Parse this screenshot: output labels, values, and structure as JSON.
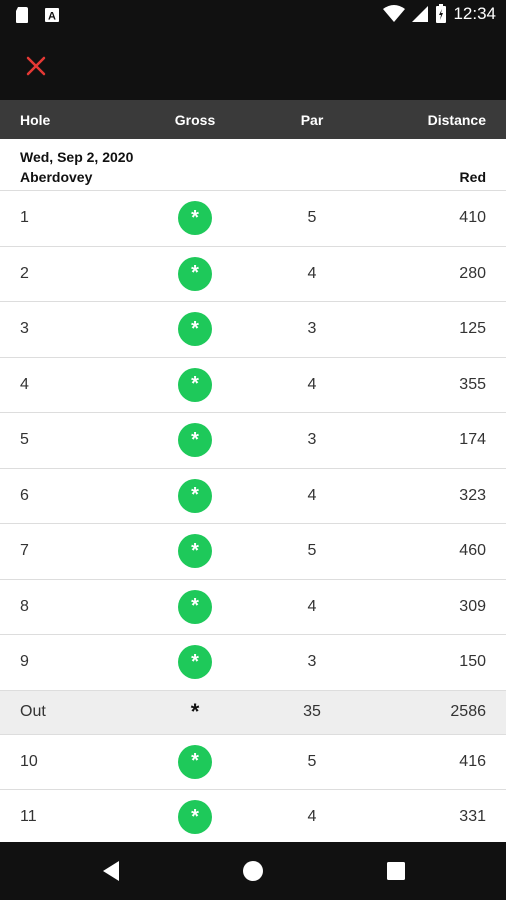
{
  "status_bar": {
    "time": "12:34",
    "icons": [
      "sd-card-icon",
      "a-notification-icon",
      "wifi-icon",
      "signal-icon",
      "battery-icon"
    ]
  },
  "app_bar": {
    "close_icon": "close-icon",
    "close_color": "#e53935"
  },
  "columns": {
    "hole": "Hole",
    "gross": "Gross",
    "par": "Par",
    "distance": "Distance"
  },
  "round": {
    "date": "Wed, Sep 2, 2020",
    "course": "Aberdovey",
    "tee": "Red"
  },
  "holes": [
    {
      "hole": "1",
      "gross": "*",
      "par": "5",
      "distance": "410"
    },
    {
      "hole": "2",
      "gross": "*",
      "par": "4",
      "distance": "280"
    },
    {
      "hole": "3",
      "gross": "*",
      "par": "3",
      "distance": "125"
    },
    {
      "hole": "4",
      "gross": "*",
      "par": "4",
      "distance": "355"
    },
    {
      "hole": "5",
      "gross": "*",
      "par": "3",
      "distance": "174"
    },
    {
      "hole": "6",
      "gross": "*",
      "par": "4",
      "distance": "323"
    },
    {
      "hole": "7",
      "gross": "*",
      "par": "5",
      "distance": "460"
    },
    {
      "hole": "8",
      "gross": "*",
      "par": "4",
      "distance": "309"
    },
    {
      "hole": "9",
      "gross": "*",
      "par": "3",
      "distance": "150"
    }
  ],
  "out_total": {
    "label": "Out",
    "gross": "*",
    "par": "35",
    "distance": "2586"
  },
  "back_holes": [
    {
      "hole": "10",
      "gross": "*",
      "par": "5",
      "distance": "416"
    },
    {
      "hole": "11",
      "gross": "*",
      "par": "4",
      "distance": "331"
    }
  ],
  "colors": {
    "gross_badge": "#1ec95a",
    "header_bg": "#3a3a3a",
    "out_row_bg": "#eeeeee"
  },
  "nav_bar": {
    "icons": [
      "back-triangle-icon",
      "home-circle-icon",
      "recents-square-icon"
    ]
  }
}
